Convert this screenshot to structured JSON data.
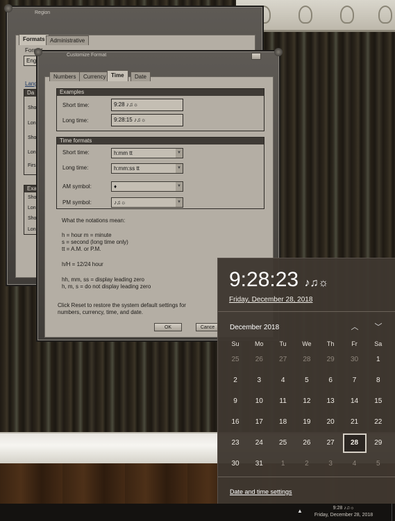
{
  "region_window": {
    "title": "Region",
    "tabs": [
      "Formats",
      "Administrative"
    ],
    "active_tab": "Formats",
    "format_label_partial": "Format",
    "format_value_partial": "Eng",
    "language_partial": "Lang",
    "date_group_partial": "Da",
    "rows_partial": [
      "Sho",
      "Lon",
      "Sho",
      "Lon",
      "Firs"
    ],
    "examples_group_partial": "Exa",
    "example_rows_partial": [
      "Sho",
      "Lon",
      "Sho",
      "Lon"
    ]
  },
  "customize_window": {
    "title": "Customize Format",
    "tabs": [
      "Numbers",
      "Currency",
      "Time",
      "Date"
    ],
    "active_tab": "Time",
    "examples": {
      "heading": "Examples",
      "short_time_label": "Short time:",
      "short_time_value": "9:28 ♪♫☼",
      "long_time_label": "Long time:",
      "long_time_value": "9:28:15 ♪♫☼"
    },
    "formats": {
      "heading": "Time formats",
      "short_time_label": "Short time:",
      "short_time_value": "h:mm tt",
      "long_time_label": "Long time:",
      "long_time_value": "h:mm:ss tt",
      "am_label": "AM symbol:",
      "am_value": "♦",
      "pm_label": "PM symbol:",
      "pm_value": "♪♫☼"
    },
    "notation": {
      "heading": "What the notations mean:",
      "line1": "h = hour   m = minute",
      "line2": "s = second (long time only)",
      "line3": "tt = A.M. or P.M.",
      "line4": "h/H = 12/24 hour",
      "line5": "hh, mm, ss = display leading zero",
      "line6": "h, m, s = do not display leading zero"
    },
    "reset_note_line1": "Click Reset to restore the system default settings for",
    "reset_note_line2": "numbers, currency, time, and date.",
    "ok_label": "OK",
    "cancel_label": "Cance"
  },
  "flyout": {
    "time": "9:28:23",
    "time_symbols": "♪♫☼",
    "date": "Friday, December 28, 2018",
    "month": "December 2018",
    "weekdays": [
      "Su",
      "Mo",
      "Tu",
      "We",
      "Th",
      "Fr",
      "Sa"
    ],
    "weeks": [
      [
        "25",
        "26",
        "27",
        "28",
        "29",
        "30",
        "1"
      ],
      [
        "2",
        "3",
        "4",
        "5",
        "6",
        "7",
        "8"
      ],
      [
        "9",
        "10",
        "11",
        "12",
        "13",
        "14",
        "15"
      ],
      [
        "16",
        "17",
        "18",
        "19",
        "20",
        "21",
        "22"
      ],
      [
        "23",
        "24",
        "25",
        "26",
        "27",
        "28",
        "29"
      ],
      [
        "30",
        "31",
        "1",
        "2",
        "3",
        "4",
        "5"
      ]
    ],
    "today": "28",
    "settings_link": "Date and time settings",
    "up_icon": "chevron-up-icon",
    "down_icon": "chevron-down-icon"
  },
  "taskbar": {
    "time": "9:28 ♪♫☼",
    "date": "Friday, December 28, 2018"
  }
}
